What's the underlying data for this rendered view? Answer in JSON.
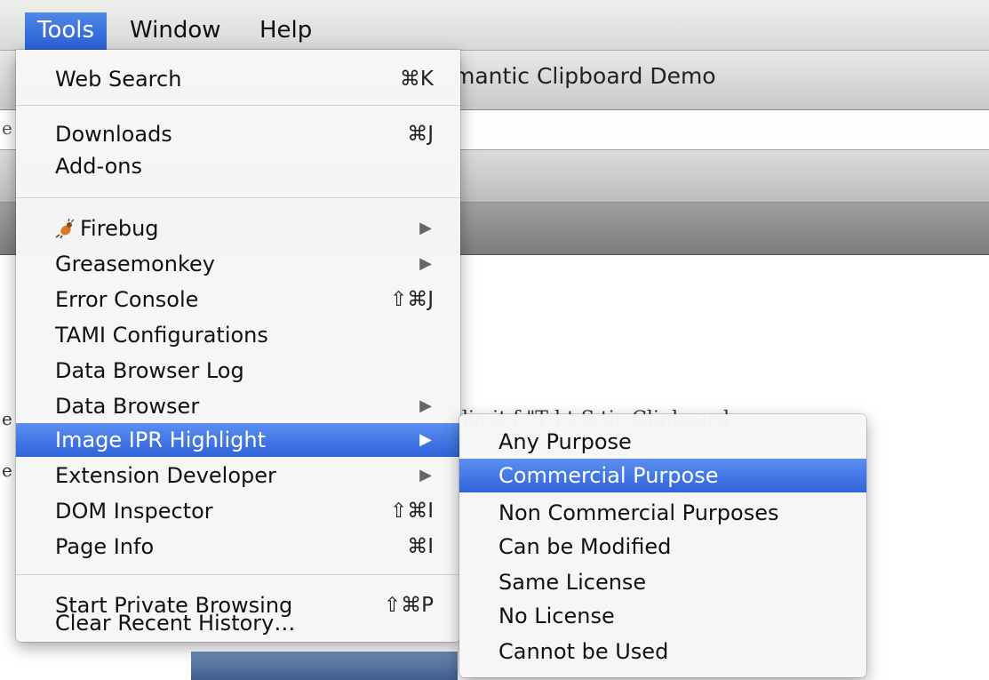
{
  "menubar": {
    "items": [
      {
        "label": "Tools",
        "active": true
      },
      {
        "label": "Window",
        "active": false
      },
      {
        "label": "Help",
        "active": false
      }
    ]
  },
  "window": {
    "title_fragment": "mantic Clipboard Demo",
    "url_fragment": "e",
    "page_fragment": "lia      it    f    \"T    l    t  S      tic Clipboard",
    "page_left_stub_1": "e",
    "page_left_stub_2": "e"
  },
  "tools_menu": {
    "items": [
      {
        "label": "Web Search",
        "shortcut": "⌘K"
      },
      {
        "label": "Downloads",
        "shortcut": "⌘J"
      },
      {
        "label": "Add-ons",
        "shortcut": ""
      },
      {
        "label": "Firebug",
        "shortcut": "",
        "submenu": true,
        "icon": "firebug-icon"
      },
      {
        "label": "Greasemonkey",
        "shortcut": "",
        "submenu": true
      },
      {
        "label": "Error Console",
        "shortcut": "⇧⌘J"
      },
      {
        "label": "TAMI Configurations",
        "shortcut": ""
      },
      {
        "label": "Data Browser Log",
        "shortcut": ""
      },
      {
        "label": "Data Browser",
        "shortcut": "",
        "submenu": true
      },
      {
        "label": "Image IPR Highlight",
        "shortcut": "",
        "submenu": true,
        "highlighted": true
      },
      {
        "label": "Extension Developer",
        "shortcut": "",
        "submenu": true
      },
      {
        "label": "DOM Inspector",
        "shortcut": "⇧⌘I"
      },
      {
        "label": "Page Info",
        "shortcut": "⌘I"
      },
      {
        "label": "Start Private Browsing",
        "shortcut": "⇧⌘P"
      },
      {
        "label": "Clear Recent History…",
        "shortcut": ""
      }
    ]
  },
  "submenu": {
    "items": [
      {
        "label": "Any Purpose"
      },
      {
        "label": "Commercial Purpose",
        "highlighted": true
      },
      {
        "label": "Non Commercial Purposes"
      },
      {
        "label": "Can be Modified"
      },
      {
        "label": "Same License"
      },
      {
        "label": "No License"
      },
      {
        "label": "Cannot be Used"
      }
    ]
  },
  "colors": {
    "highlight": "#3a6fe0",
    "menu_bg": "#f6f6f6"
  },
  "icons": {
    "submenu_arrow": "triangle-right-icon",
    "firebug": "firebug-icon"
  }
}
